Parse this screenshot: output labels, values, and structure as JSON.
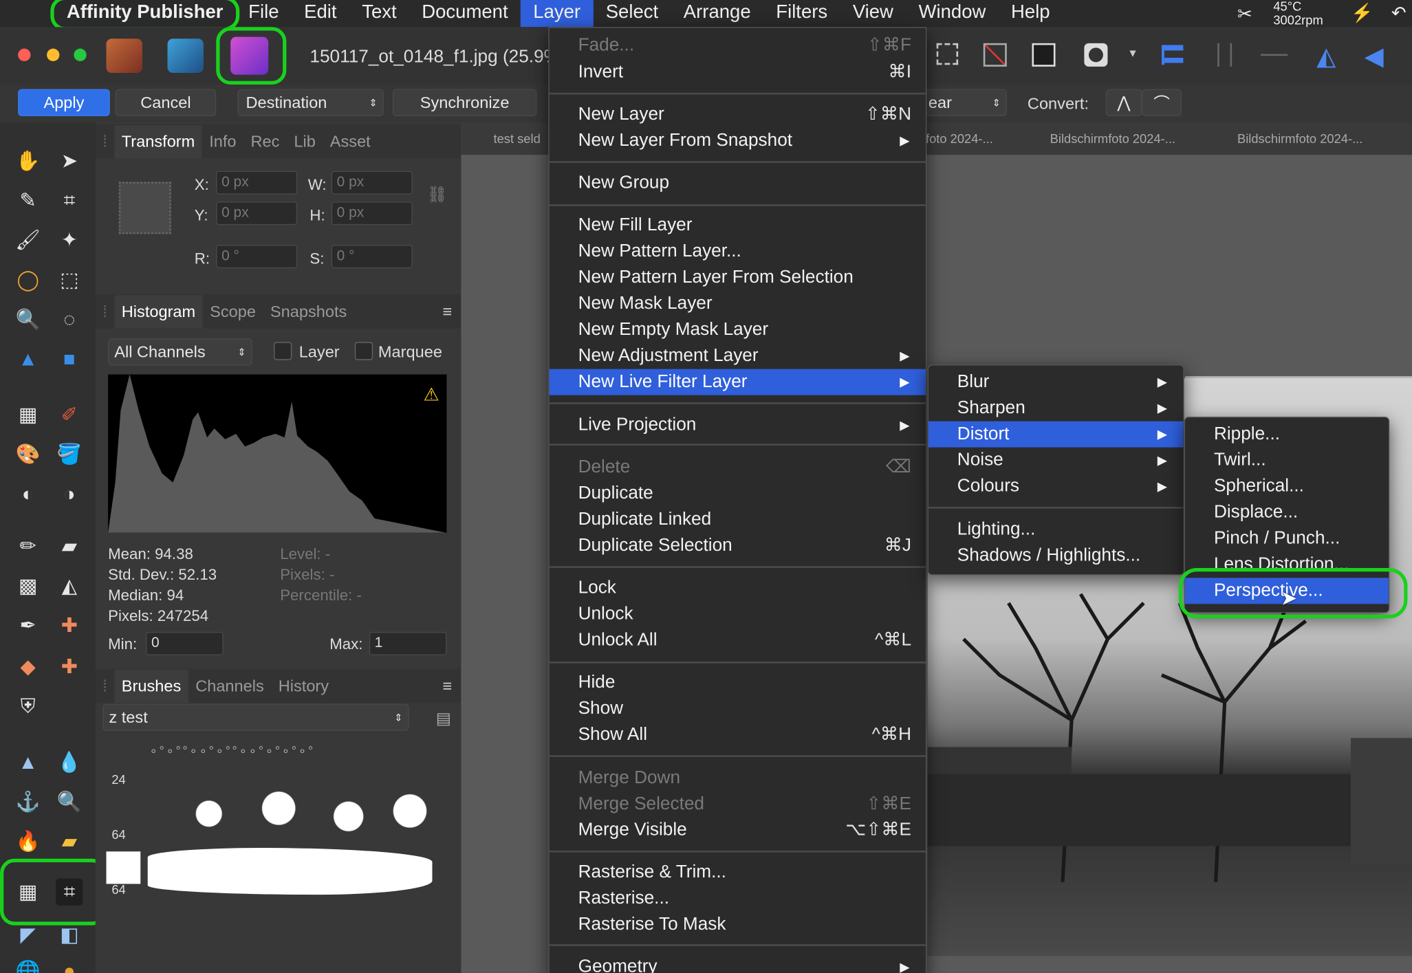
{
  "menubar": {
    "app": "Affinity Publisher",
    "items": [
      "File",
      "Edit",
      "Text",
      "Document",
      "Layer",
      "Select",
      "Arrange",
      "Filters",
      "View",
      "Window",
      "Help"
    ],
    "status": {
      "temp": "45°C",
      "rpm": "3002rpm"
    }
  },
  "window": {
    "title": "150117_ot_0148_f1.jpg (25.9%)"
  },
  "context": {
    "apply": "Apply",
    "cancel": "Cancel",
    "destination": "Destination",
    "synchronize": "Synchronize",
    "linear": "ear",
    "convert": "Convert:"
  },
  "doc_tabs": [
    "test seld",
    "foto 2024-...",
    "Bildschirmfoto 2024-...",
    "Bildschirmfoto 2024-..."
  ],
  "transform": {
    "tabs": [
      "Transform",
      "Info",
      "Rec",
      "Lib",
      "Asset"
    ],
    "x_label": "X:",
    "y_label": "Y:",
    "w_label": "W:",
    "h_label": "H:",
    "r_label": "R:",
    "s_label": "S:",
    "x": "0 px",
    "y": "0 px",
    "w": "0 px",
    "h": "0 px",
    "r": "0 °",
    "s": "0 °"
  },
  "histogram": {
    "tabs": [
      "Histogram",
      "Scope",
      "Snapshots"
    ],
    "channels": "All Channels",
    "layer": "Layer",
    "marquee": "Marquee",
    "mean": "Mean: 94.38",
    "std": "Std. Dev.: 52.13",
    "median": "Median: 94",
    "pixels": "Pixels: 247254",
    "level": "Level: -",
    "pixels2": "Pixels: -",
    "percentile": "Percentile: -",
    "min_label": "Min:",
    "min": "0",
    "max_label": "Max:",
    "max": "1"
  },
  "brushes": {
    "tabs": [
      "Brushes",
      "Channels",
      "History"
    ],
    "category": "z test",
    "sizes": [
      "24",
      "64",
      "64"
    ]
  },
  "layer_menu": [
    {
      "label": "Fade...",
      "shortcut": "⇧⌘F",
      "disabled": true
    },
    {
      "label": "Invert",
      "shortcut": "⌘I"
    },
    {
      "label": "New Layer",
      "shortcut": "⇧⌘N"
    },
    {
      "label": "New Layer From Snapshot",
      "submenu": true
    },
    {
      "label": "New Group"
    },
    {
      "label": "New Fill Layer"
    },
    {
      "label": "New Pattern Layer..."
    },
    {
      "label": "New Pattern Layer From Selection"
    },
    {
      "label": "New Mask Layer"
    },
    {
      "label": "New Empty Mask Layer"
    },
    {
      "label": "New Adjustment Layer",
      "submenu": true
    },
    {
      "label": "New Live Filter Layer",
      "submenu": true,
      "selected": true
    },
    {
      "label": "Live Projection",
      "submenu": true
    },
    {
      "label": "Delete",
      "shortcut": "⌫",
      "disabled": true
    },
    {
      "label": "Duplicate"
    },
    {
      "label": "Duplicate Linked"
    },
    {
      "label": "Duplicate Selection",
      "shortcut": "⌘J"
    },
    {
      "label": "Lock"
    },
    {
      "label": "Unlock"
    },
    {
      "label": "Unlock All",
      "shortcut": "^⌘L"
    },
    {
      "label": "Hide"
    },
    {
      "label": "Show"
    },
    {
      "label": "Show All",
      "shortcut": "^⌘H"
    },
    {
      "label": "Merge Down",
      "disabled": true
    },
    {
      "label": "Merge Selected",
      "shortcut": "⇧⌘E",
      "disabled": true
    },
    {
      "label": "Merge Visible",
      "shortcut": "⌥⇧⌘E"
    },
    {
      "label": "Rasterise & Trim..."
    },
    {
      "label": "Rasterise..."
    },
    {
      "label": "Rasterise To Mask"
    },
    {
      "label": "Geometry",
      "submenu": true
    }
  ],
  "filter_menu": [
    {
      "label": "Blur",
      "submenu": true
    },
    {
      "label": "Sharpen",
      "submenu": true
    },
    {
      "label": "Distort",
      "submenu": true,
      "selected": true
    },
    {
      "label": "Noise",
      "submenu": true
    },
    {
      "label": "Colours",
      "submenu": true
    },
    {
      "label": "Lighting..."
    },
    {
      "label": "Shadows / Highlights..."
    }
  ],
  "distort_menu": [
    {
      "label": "Ripple..."
    },
    {
      "label": "Twirl..."
    },
    {
      "label": "Spherical..."
    },
    {
      "label": "Displace..."
    },
    {
      "label": "Pinch / Punch..."
    },
    {
      "label": "Lens Distortion..."
    },
    {
      "label": "Perspective...",
      "selected": true
    }
  ],
  "colors": {
    "accent": "#2f5fdb",
    "highlight": "#19d11d",
    "warning": "#f5c518"
  }
}
